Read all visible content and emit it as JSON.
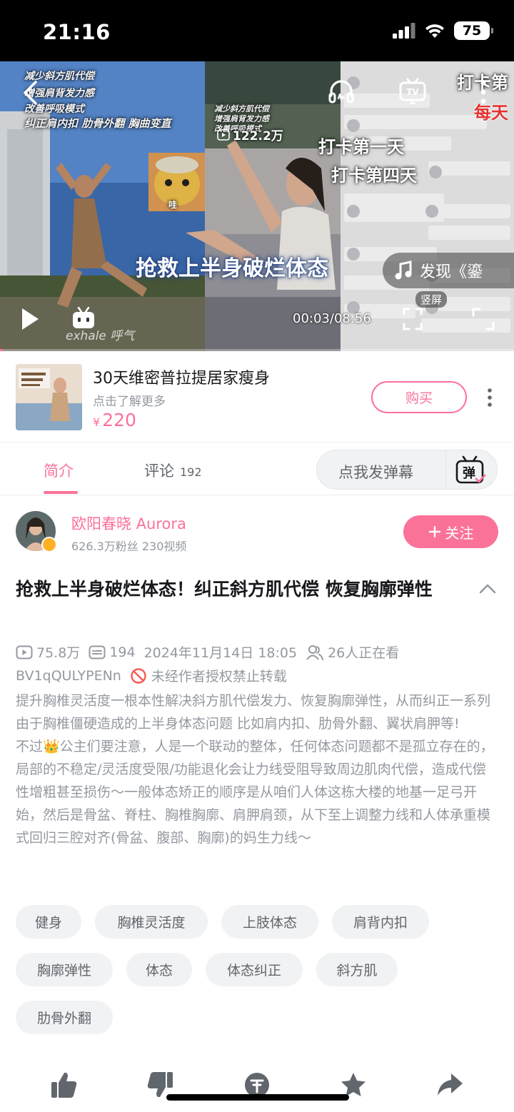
{
  "status_bar": {
    "time": "21:16",
    "battery": "75"
  },
  "video": {
    "overlay_small_text": [
      "减少斜方肌代偿",
      "增强肩背发力感",
      "改善呼吸模式",
      "纠正肩内扣 肋骨外翻 胸曲变直"
    ],
    "mini_overlay_text": [
      "减少斜方肌代偿",
      "增强肩背发力感",
      "改善呼吸模式"
    ],
    "play_count_overlay": "122.2万",
    "wa_text": "哇",
    "checkin_day1": "打卡第一天",
    "checkin_day4": "打卡第四天",
    "checkin_top": "打卡第",
    "checkin_red": "每天",
    "headline": "抢救上半身破烂体态",
    "music_label": "发现《鎏",
    "vertical_label": "竖屏",
    "time_display": "00:03/08:56",
    "watermark": "exhale 呼气",
    "progress_fraction": 0.006
  },
  "product": {
    "title": "30天维密普拉提居家瘦身",
    "subtitle": "点击了解更多",
    "currency": "¥",
    "price": "220",
    "buy_label": "购买"
  },
  "tabs": {
    "intro_label": "简介",
    "comments_label": "评论",
    "comments_count": "192",
    "danmaku_placeholder": "点我发弹幕",
    "danmaku_icon_char": "弹"
  },
  "uploader": {
    "name": "欧阳春晓 Aurora",
    "stats": "626.3万粉丝  230视频",
    "follow_label": "关注"
  },
  "title": "抢救上半身破烂体态！纠正斜方肌代偿 恢复胸廓弹性",
  "meta": {
    "views": "75.8万",
    "danmaku": "194",
    "datetime": "2024年11月14日 18:05",
    "watching": "26人正在看",
    "bvid": "BV1qQULYPENn",
    "no_reprint": "未经作者授权禁止转载"
  },
  "description": "提升胸椎灵活度一根本性解决斜方肌代偿发力、恢复胸廓弹性，从而纠正一系列由于胸椎僵硬造成的上半身体态问题 比如肩内扣、肋骨外翻、翼状肩胛等!\n不过👑公主们要注意，人是一个联动的整体，任何体态问题都不是孤立存在的，局部的不稳定/灵活度受限/功能退化会让力线受阻导致周边肌肉代偿，造成代偿性增粗甚至损伤～一般体态矫正的顺序是从咱们人体这栋大楼的地基一足弓开始，然后是骨盆、脊柱、胸椎胸廓、肩胛肩颈，从下至上调整力线和人体承重模式回归三腔对齐(骨盆、腹部、胸廓)的妈生力线～",
  "tags": [
    "健身",
    "胸椎灵活度",
    "上肢体态",
    "肩背内扣",
    "胸廓弹性",
    "体态",
    "体态纠正",
    "斜方肌",
    "肋骨外翻"
  ],
  "colors": {
    "accent": "#fb7299",
    "text": "#18191c",
    "muted": "#9499a0",
    "tag_bg": "#f1f2f3",
    "headline_glow": "#2e4d8f"
  }
}
